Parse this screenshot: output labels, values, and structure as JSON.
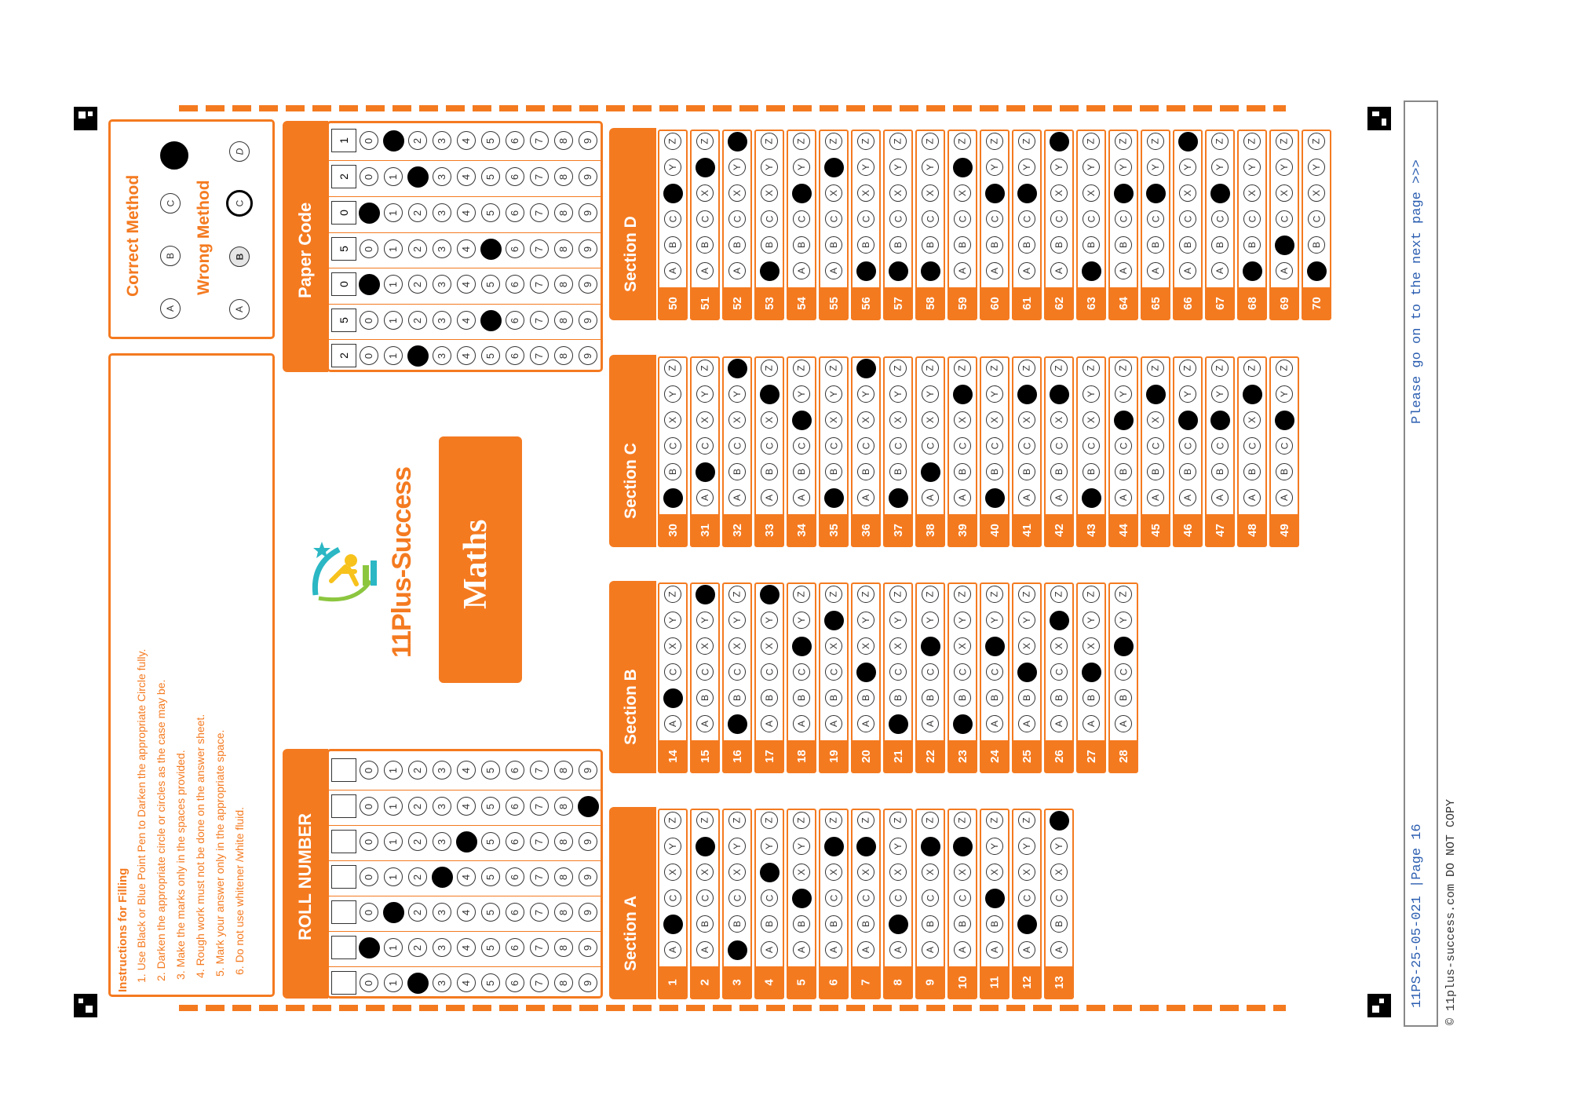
{
  "header": {
    "instructions_title": "Instructions for Filling",
    "instructions": [
      "1. Use Black or Blue Point Pen to Darken the appropriate Circle fully.",
      "2. Darken the appropriate circle or circles as the case may be.",
      "3. Make the marks only in the spaces provided.",
      "4. Rough work must not be done on the answer sheet.",
      "5. Mark your answer only in the appropriate space.",
      "6. Do not use whitener /white fluid."
    ],
    "correct_method_label": "Correct Method",
    "wrong_method_label": "Wrong Method",
    "method_letters": [
      "A",
      "B",
      "C",
      "D"
    ],
    "brand": "11Plus-Success",
    "subject": "Maths",
    "roll_number_label": "ROLL NUMBER",
    "paper_code_label": "Paper Code",
    "paper_code_digits": [
      "2",
      "5",
      "0",
      "5",
      "0",
      "2",
      "1"
    ]
  },
  "roll_number": {
    "filled": [
      2,
      0,
      1,
      3,
      4,
      9,
      null
    ]
  },
  "paper_code": {
    "filled": [
      2,
      5,
      0,
      5,
      0,
      2,
      1
    ]
  },
  "answer_letters": [
    "A",
    "B",
    "C",
    "X",
    "Y",
    "Z"
  ],
  "sections": [
    {
      "name": "Section A",
      "start": 1,
      "answers": [
        "B",
        "Y",
        "A",
        "X",
        "C",
        "Y",
        "Y",
        "B",
        "Y",
        "Y",
        "C",
        "B",
        "Z"
      ]
    },
    {
      "name": "Section B",
      "start": 14,
      "answers": [
        "B",
        "Z",
        "A",
        "Z",
        "X",
        "Y",
        "C",
        "A",
        "X",
        "A",
        "X",
        "C",
        "Y",
        "C",
        "X"
      ]
    },
    {
      "name": "Section C",
      "start": 30,
      "answers": [
        "A",
        "B",
        "Z",
        "Y",
        "X",
        "A",
        "Z",
        "A",
        "B",
        "Y",
        "A",
        "Y",
        "Y",
        "A",
        "X",
        "Y",
        "X",
        "X",
        "Y",
        "X"
      ]
    },
    {
      "name": "Section D",
      "start": 50,
      "answers": [
        "X",
        "Y",
        "Z",
        "A",
        "X",
        "Y",
        "A",
        "A",
        "A",
        "Y",
        "X",
        "X",
        "Z",
        "A",
        "X",
        "X",
        "Z",
        "X",
        "A",
        "B",
        "A"
      ]
    }
  ],
  "footer": {
    "page_ref": "11PS-25-05-021 |Page 16",
    "next_page": "Please go on to the next page >>>",
    "copyright": "© 11plus-success.com DO NOT COPY"
  },
  "colors": {
    "accent": "#f47a20",
    "footer_text": "#2a5db0"
  },
  "icons": [
    "corner-marker-icon",
    "brand-logo-icon"
  ]
}
